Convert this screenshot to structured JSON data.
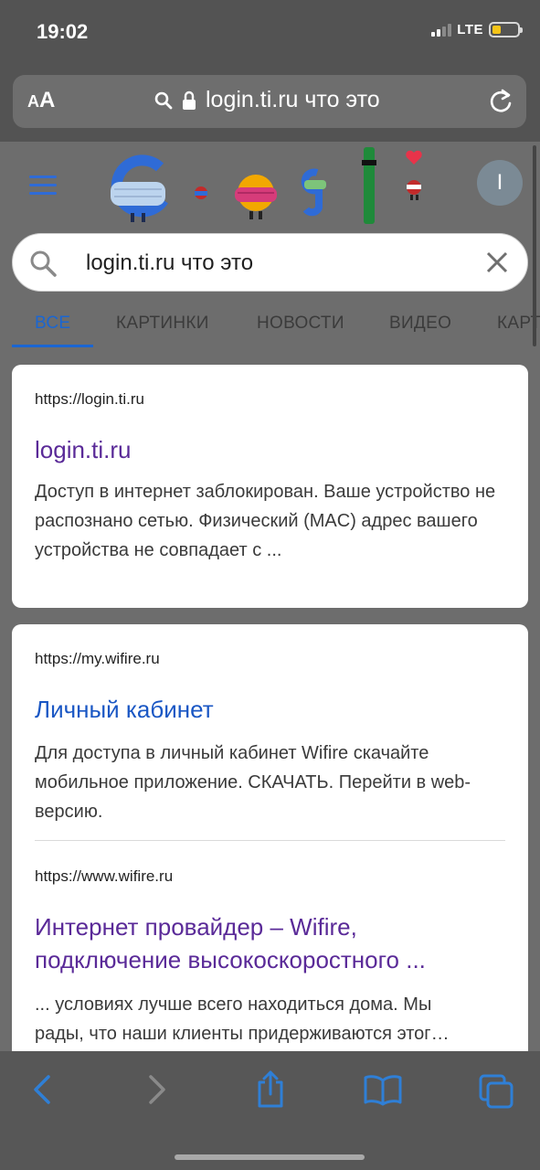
{
  "status": {
    "time": "19:02",
    "network": "LTE"
  },
  "browser": {
    "text_size_small": "A",
    "text_size_big": "A",
    "url": "login.ti.ru что это"
  },
  "google": {
    "avatar_letter": "I",
    "search_query": "login.ti.ru что это",
    "tabs": [
      "ВСЕ",
      "КАРТИНКИ",
      "НОВОСТИ",
      "ВИДЕО",
      "КАРТЫ"
    ]
  },
  "results": [
    {
      "cite": "https://login.ti.ru",
      "title": "login.ti.ru",
      "snippet": "Доступ в интернет заблокирован. Ваше устройство не распознано сетью. Физический (MAC) адрес вашего устройства не совпадает с ..."
    },
    {
      "cite": "https://my.wifire.ru",
      "title": "Личный кабинет",
      "snippet": "Для доступа в личный кабинет Wifire скачайте мобильное приложение. СКАЧАТЬ. Перейти в web-версию."
    },
    {
      "cite": "https://www.wifire.ru",
      "title_line1": "Интернет провайдер – Wifire,",
      "title_line2": "подключение высокоскоростного ...",
      "snippet_line1": "... условиях лучше всего находиться дома. Мы",
      "snippet_line2": "рады, что наши клиенты придерживаются этог…"
    }
  ],
  "colors": {
    "visited_link": "#5a2a98",
    "link": "#1a57c4",
    "active_tab": "#1a66d2"
  },
  "icons": [
    "search-icon",
    "lock-icon",
    "reload-icon",
    "menu-icon",
    "clear-icon",
    "back-icon",
    "forward-icon",
    "share-icon",
    "bookmarks-icon",
    "tabs-icon"
  ]
}
